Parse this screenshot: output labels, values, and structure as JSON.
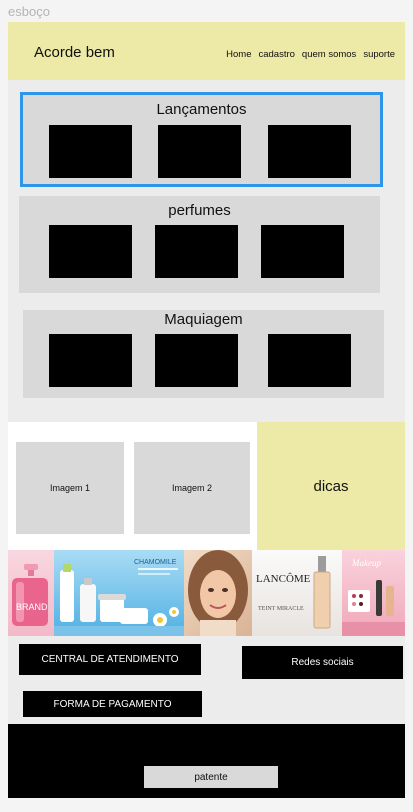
{
  "frame_label": "esboço",
  "header": {
    "brand": "Acorde bem",
    "nav": [
      "Home",
      "cadastro",
      "quem somos",
      "suporte"
    ]
  },
  "sections": [
    {
      "title": "Lançamentos"
    },
    {
      "title": "perfumes"
    },
    {
      "title": "Maquiagem"
    }
  ],
  "promo": {
    "image1_label": "Imagem 1",
    "image2_label": "Imagem 2",
    "tips_label": "dicas"
  },
  "banner": {
    "brand_text": "BRAND",
    "chamomile_text": "CHAMOMILE",
    "lancome_text": "LANCÔME",
    "lancome_product": "TEINT MIRACLE",
    "makeup_text": "Makeup"
  },
  "footer_buttons": {
    "central": "CENTRAL DE ATENDIMENTO",
    "social": "Redes sociais",
    "payment": "FORMA DE PAGAMENTO"
  },
  "footer": {
    "patent": "patente"
  },
  "colors": {
    "header_bg": "#ede9a6",
    "section_bg": "#d9d9d9",
    "highlight_border": "#2f95ea",
    "footer_bg": "#000000"
  }
}
